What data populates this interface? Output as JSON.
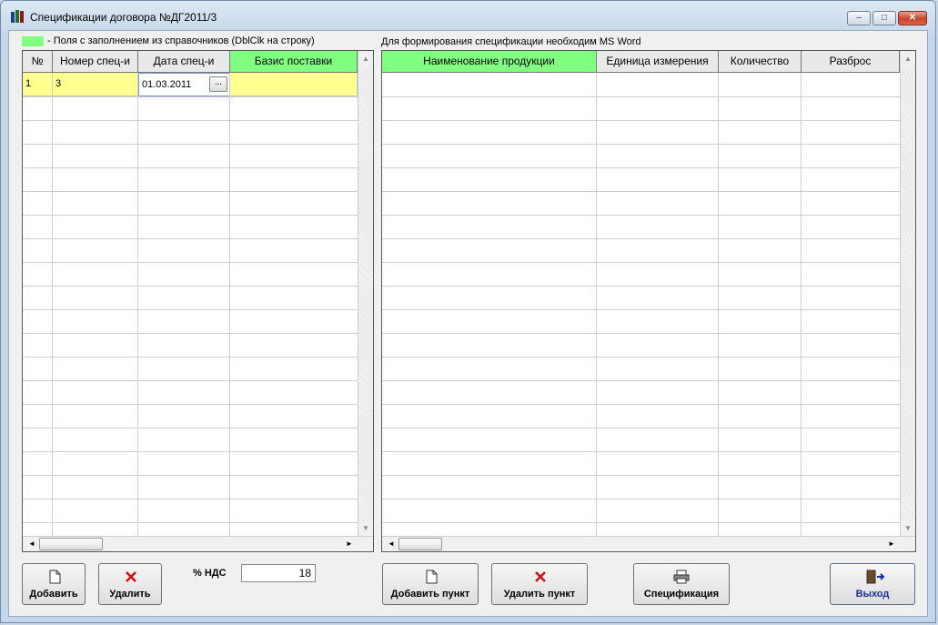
{
  "window": {
    "title": "Спецификации договора №ДГ2011/3",
    "minimize_label": "–",
    "restore_label": "□",
    "close_label": "✕"
  },
  "legend": {
    "swatch_color": "#80ff80",
    "text": "-  Поля с заполнением из справочников (DblClk на строку)"
  },
  "note": "Для формирования спецификации необходим MS Word",
  "left_table": {
    "columns": [
      "№",
      "Номер спец-и",
      "Дата спец-и",
      "Базис поставки"
    ],
    "rows": [
      {
        "num": "1",
        "spec_number": "3",
        "spec_date": "01.03.2011",
        "delivery_basis": ""
      }
    ],
    "date_picker_label": "..."
  },
  "right_table": {
    "columns": [
      "Наименование продукции",
      "Единица измерения",
      "Количество",
      "Разброс"
    ],
    "rows": []
  },
  "scroll": {
    "up": "▲",
    "down": "▼",
    "left": "◄",
    "right": "►"
  },
  "vat": {
    "label": "% НДС",
    "value": "18"
  },
  "buttons": {
    "add": "Добавить",
    "delete": "Удалить",
    "add_item": "Добавить пункт",
    "delete_item": "Удалить пункт",
    "specification": "Спецификация",
    "exit": "Выход"
  },
  "icons": {
    "add": "page-icon",
    "delete": "red-x-icon",
    "spec": "printer-icon",
    "exit": "door-exit-icon"
  }
}
